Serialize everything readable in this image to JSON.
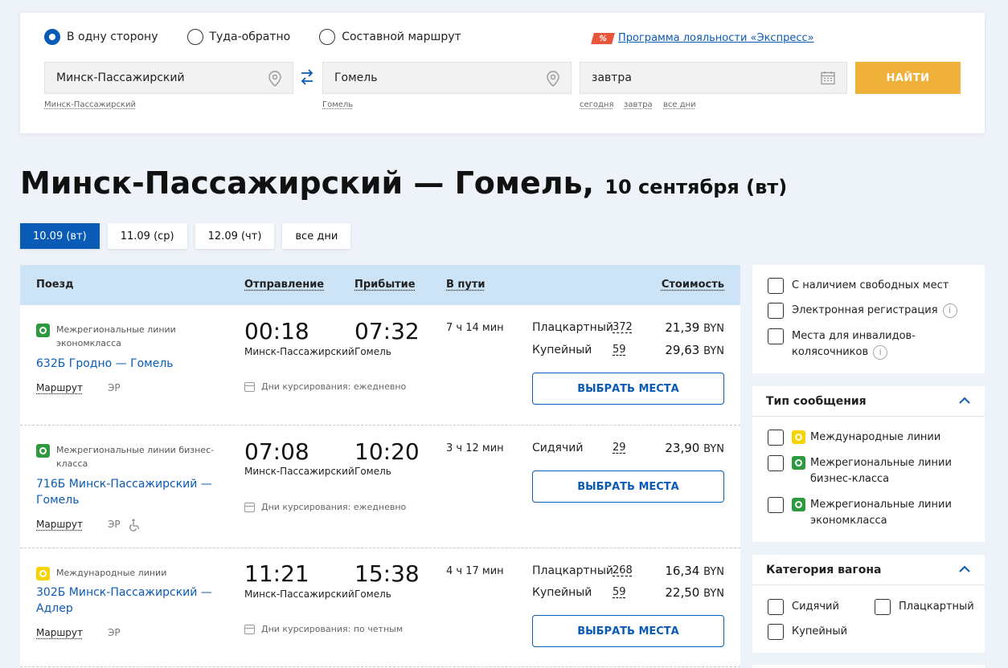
{
  "search": {
    "trip_types": [
      {
        "label": "В одну сторону",
        "selected": true
      },
      {
        "label": "Туда-обратно",
        "selected": false
      },
      {
        "label": "Составной маршрут",
        "selected": false
      }
    ],
    "loyalty_badge": "%",
    "loyalty_link": "Программа лояльности «Экспресс»",
    "from_value": "Минск-Пассажирский",
    "to_value": "Гомель",
    "date_value": "завтра",
    "from_hint": "Минск-Пассажирский",
    "to_hint": "Гомель",
    "date_hints": [
      "сегодня",
      "завтра",
      "все дни"
    ],
    "find_button": "НАЙТИ"
  },
  "title": {
    "route": "Минск-Пассажирский — Гомель,",
    "date": "10 сентября (вт)"
  },
  "day_tabs": [
    "10.09 (вт)",
    "11.09 (ср)",
    "12.09 (чт)",
    "все дни"
  ],
  "table": {
    "headers": {
      "train": "Поезд",
      "departure": "Отправление",
      "arrival": "Прибытие",
      "duration": "В пути",
      "cost": "Стоимость"
    },
    "route_link": "Маршрут",
    "er": "ЭР",
    "days_prefix": "Дни курсирования:",
    "choose_button": "ВЫБРАТЬ МЕСТА",
    "currency": "BYN",
    "rows": [
      {
        "category": "Межрегиональные линии экономкласса",
        "category_color": "#2e9a3f",
        "train": "632Б Гродно — Гомель",
        "dep_time": "00:18",
        "dep_station": "Минск-Пассажирский",
        "arr_time": "07:32",
        "arr_station": "Гомель",
        "duration": "7 ч 14 мин",
        "days": "Дни курсирования: ежедневно",
        "seats": [
          {
            "type": "Плацкартный",
            "count": "372",
            "price": "21,39"
          },
          {
            "type": "Купейный",
            "count": "59",
            "price": "29,63"
          }
        ]
      },
      {
        "category": "Межрегиональные линии бизнес-класса",
        "category_color": "#2e9a3f",
        "train": "716Б Минск-Пассажирский — Гомель",
        "dep_time": "07:08",
        "dep_station": "Минск-Пассажирский",
        "arr_time": "10:20",
        "arr_station": "Гомель",
        "duration": "3 ч 12 мин",
        "days": "Дни курсирования: ежедневно",
        "seats": [
          {
            "type": "Сидячий",
            "count": "29",
            "price": "23,90"
          }
        ]
      },
      {
        "category": "Международные линии",
        "category_color": "#f5d400",
        "train": "302Б Минск-Пассажирский — Адлер",
        "dep_time": "11:21",
        "dep_station": "Минск-Пассажирский",
        "arr_time": "15:38",
        "arr_station": "Гомель",
        "duration": "4 ч 17 мин",
        "days": "Дни курсирования: по четным",
        "seats": [
          {
            "type": "Плацкартный",
            "count": "268",
            "price": "16,34"
          },
          {
            "type": "Купейный",
            "count": "59",
            "price": "22,50"
          }
        ]
      }
    ]
  },
  "filters": {
    "general": [
      "С наличием свободных мест",
      "Электронная регистрация",
      "Места для инвалидов-колясочников"
    ],
    "info_glyph": "i",
    "message_type_title": "Тип сообщения",
    "message_types": [
      "Международные линии",
      "Межрегиональные линии бизнес-класса",
      "Межрегиональные линии экономкласса"
    ],
    "car_category_title": "Категория вагона",
    "car_categories": [
      "Сидячий",
      "Плацкартный",
      "Купейный"
    ]
  },
  "colors": {
    "accent": "#0a5bb5",
    "find_button": "#f0b13b",
    "table_header": "#cde3f6"
  }
}
